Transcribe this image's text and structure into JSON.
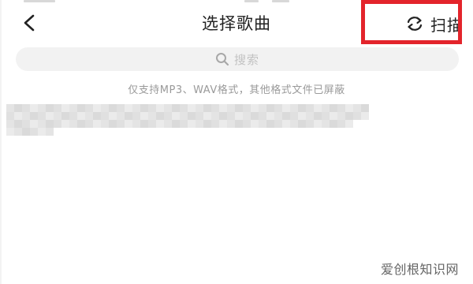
{
  "header": {
    "title": "选择歌曲",
    "scan_label": "扫描",
    "back_icon": "chevron-left-icon",
    "scan_icon": "refresh-icon"
  },
  "search": {
    "placeholder": "搜索",
    "icon": "search-icon"
  },
  "hint": "仅支持MP3、WAV格式，其他格式文件已屏蔽",
  "highlight_color": "#e3242b",
  "watermark": "爱创根知识网"
}
